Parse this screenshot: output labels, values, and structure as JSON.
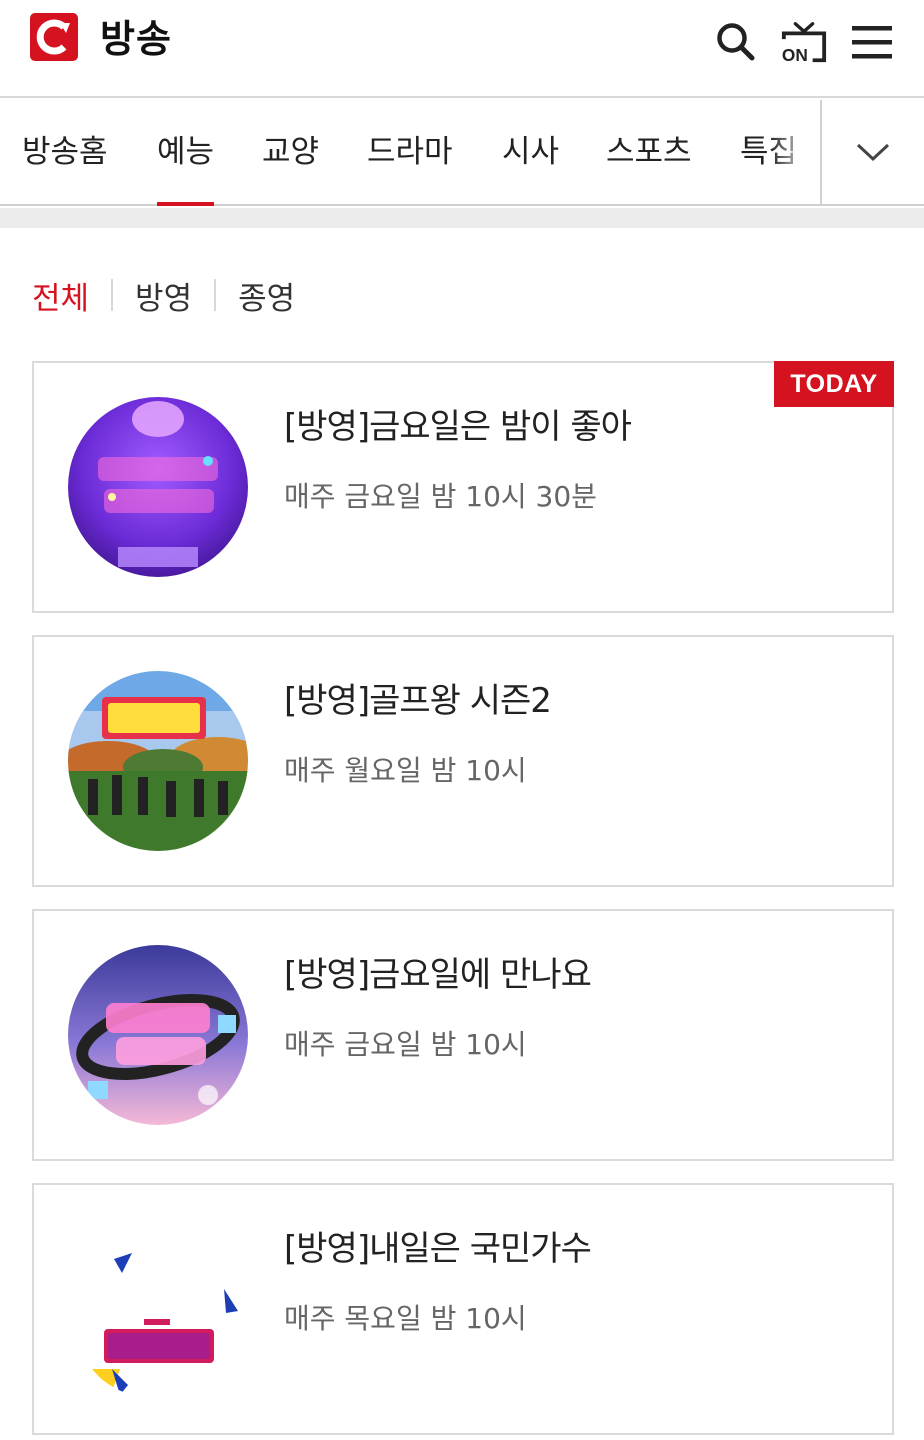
{
  "header": {
    "title": "방송",
    "logo_icon": "channel-c-logo-icon",
    "search_icon": "search-icon",
    "on_air_icon": "on-air-tv-icon",
    "menu_icon": "hamburger-menu-icon",
    "brand_color": "#d5121f"
  },
  "categories": {
    "items": [
      {
        "label": "방송홈"
      },
      {
        "label": "예능",
        "active": true
      },
      {
        "label": "교양"
      },
      {
        "label": "드라마"
      },
      {
        "label": "시사"
      },
      {
        "label": "스포츠"
      },
      {
        "label": "특집"
      }
    ],
    "expand_icon": "chevron-down-icon"
  },
  "filters": {
    "all": "전체",
    "airing": "방영",
    "ended": "종영",
    "active": "전체"
  },
  "programs": [
    {
      "title": "[방영]금요일은 밤이 좋아",
      "schedule": "매주 금요일 밤 10시 30분",
      "badge": "TODAY"
    },
    {
      "title": "[방영]골프왕 시즌2",
      "schedule": "매주 월요일 밤 10시"
    },
    {
      "title": "[방영]금요일에 만나요",
      "schedule": "매주 금요일 밤 10시"
    },
    {
      "title": "[방영]내일은 국민가수",
      "schedule": "매주 목요일 밤 10시"
    }
  ]
}
